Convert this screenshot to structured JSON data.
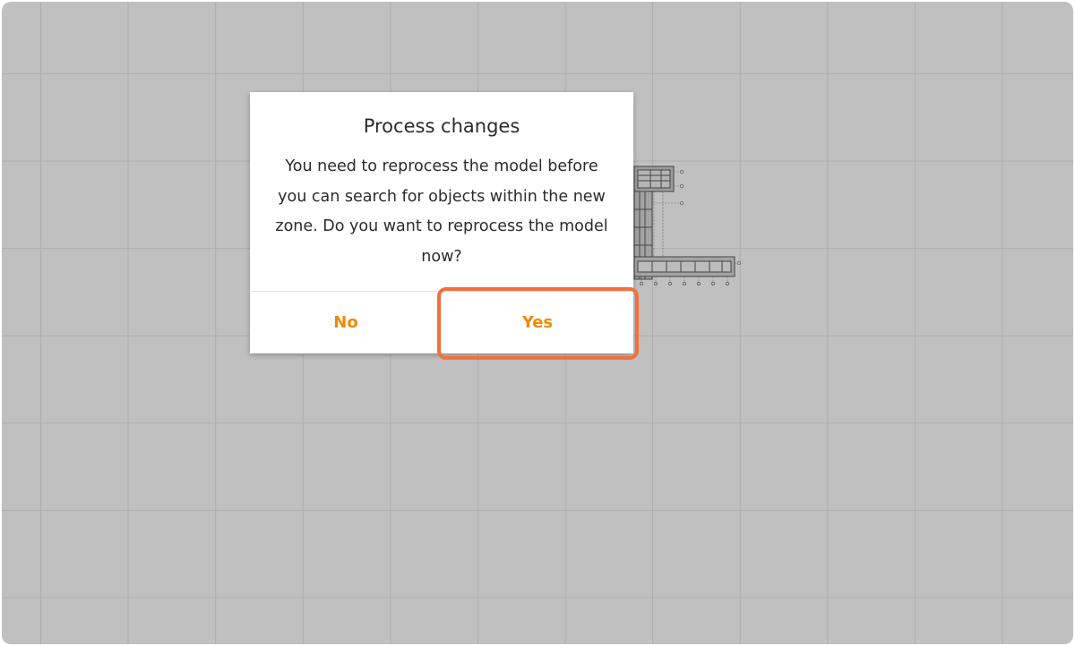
{
  "dialog": {
    "title": "Process changes",
    "message": "You need to reprocess the model before you can search for objects within the new zone. Do you want to reprocess the model now?",
    "no_label": "No",
    "yes_label": "Yes"
  },
  "colors": {
    "canvas": "#c0c0c0",
    "grid_line": "#adadad",
    "button_text": "#f08a00",
    "highlight": "#f46f3c"
  }
}
